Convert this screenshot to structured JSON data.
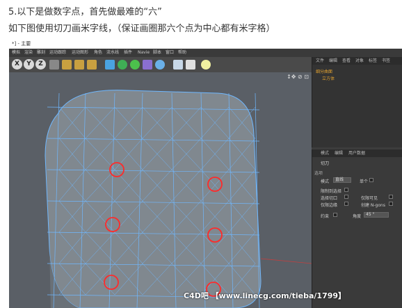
{
  "captions": {
    "line1": "5.以下是做数字点，首先做最难的“六”",
    "line2": "如下图使用切刀画米字线，（保证画圈那六个点为中心都有米字格）"
  },
  "app": {
    "title": "*] - 主要",
    "menu": [
      "模拟",
      "渲染",
      "雕刻",
      "运动跟踪",
      "运动图形",
      "角色",
      "流水线",
      "插件",
      "Navie",
      "脚本",
      "窗口",
      "帮助"
    ],
    "toolbar_axes": [
      "X",
      "Y",
      "Z"
    ],
    "viewport_controls": "↕✥ ⊘ ⊡"
  },
  "object_manager": {
    "tabs": [
      "文件",
      "编辑",
      "查看",
      "对象",
      "标签",
      "书签"
    ],
    "items": [
      "细分曲面",
      "立方体"
    ]
  },
  "attributes": {
    "tabs": [
      "模式",
      "编辑",
      "用户数据"
    ],
    "tool_name": "切刀",
    "section": "选项",
    "mode_label": "模式",
    "mode_value": "直线",
    "single_label": "单个",
    "options": [
      "限制到选择",
      "选择切口",
      "仅限可见",
      "仅限边缘",
      "创建 N-gons"
    ],
    "constrain_label": "约束",
    "angle_label": "角度",
    "angle_value": "45 °"
  },
  "watermark": "C4D吧 【www.linecg.com/tieba/1799】",
  "colors": {
    "viewport_bg": "#5a5f66",
    "mesh_face": "#80888f",
    "mesh_line": "#6fb8ff",
    "circle": "#ff2a2a",
    "panel_bg": "#333333",
    "object_color": "#e0a030"
  }
}
